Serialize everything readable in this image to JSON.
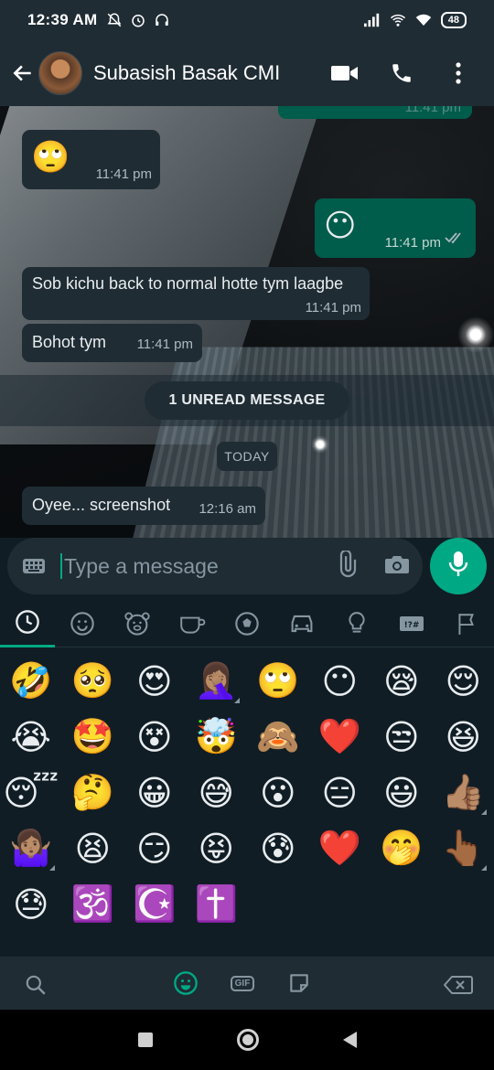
{
  "statusbar": {
    "time": "12:39 AM",
    "battery": "48",
    "left_icons": [
      "mute-bell-icon",
      "alarm-icon",
      "headphones-icon"
    ],
    "right_icons": [
      "signal-icon",
      "wifi-calling-icon",
      "wifi-icon",
      "battery-icon"
    ]
  },
  "header": {
    "contact_name": "Subasish Basak CMI",
    "actions": [
      "video-call-icon",
      "voice-call-icon",
      "more-options-icon"
    ]
  },
  "chat": {
    "partial_top_time": "11:41 pm",
    "messages": [
      {
        "direction": "in",
        "emoji": "🙄",
        "time": "11:41 pm"
      },
      {
        "direction": "out",
        "emoji": "😶",
        "time": "11:41 pm",
        "status": "read"
      },
      {
        "direction": "in",
        "text": "Sob kichu back to normal hotte tym laagbe",
        "time": "11:41 pm"
      },
      {
        "direction": "in",
        "text": "Bohot tym",
        "time": "11:41 pm"
      },
      {
        "direction": "in",
        "text": "Oyee... screenshot",
        "time": "12:16 am"
      }
    ],
    "unread_label": "1 UNREAD MESSAGE",
    "date_chip": "TODAY"
  },
  "input": {
    "placeholder": "Type a message"
  },
  "emoji_panel": {
    "categories": [
      "recent-icon",
      "smileys-icon",
      "animals-icon",
      "food-icon",
      "activity-icon",
      "travel-icon",
      "objects-icon",
      "symbols-icon",
      "flags-icon"
    ],
    "emojis": [
      "🤣",
      "🥺",
      "😍",
      "🤦🏽‍♀️",
      "🙄",
      "😶",
      "😪",
      "😌",
      "😭",
      "🤩",
      "😵",
      "🤯",
      "🙈",
      "❤️",
      "😒",
      "😆",
      "😴",
      "🤔",
      "😀",
      "😅",
      "😮",
      "😑",
      "😃",
      "👍🏽",
      "🤷🏽‍♀️",
      "😫",
      "😏",
      "😝",
      "😰",
      "❤️",
      "🤭",
      "👆🏾",
      "😓",
      "🕉️",
      "☪️",
      "✝️"
    ],
    "toolbar": {
      "gif_label": "GIF"
    }
  },
  "colors": {
    "accent": "#00a884",
    "header_bg": "#1f2c34",
    "incoming_bubble": "#1f2c34",
    "outgoing_bubble": "#005c4b",
    "panel_bg": "#101d25"
  }
}
